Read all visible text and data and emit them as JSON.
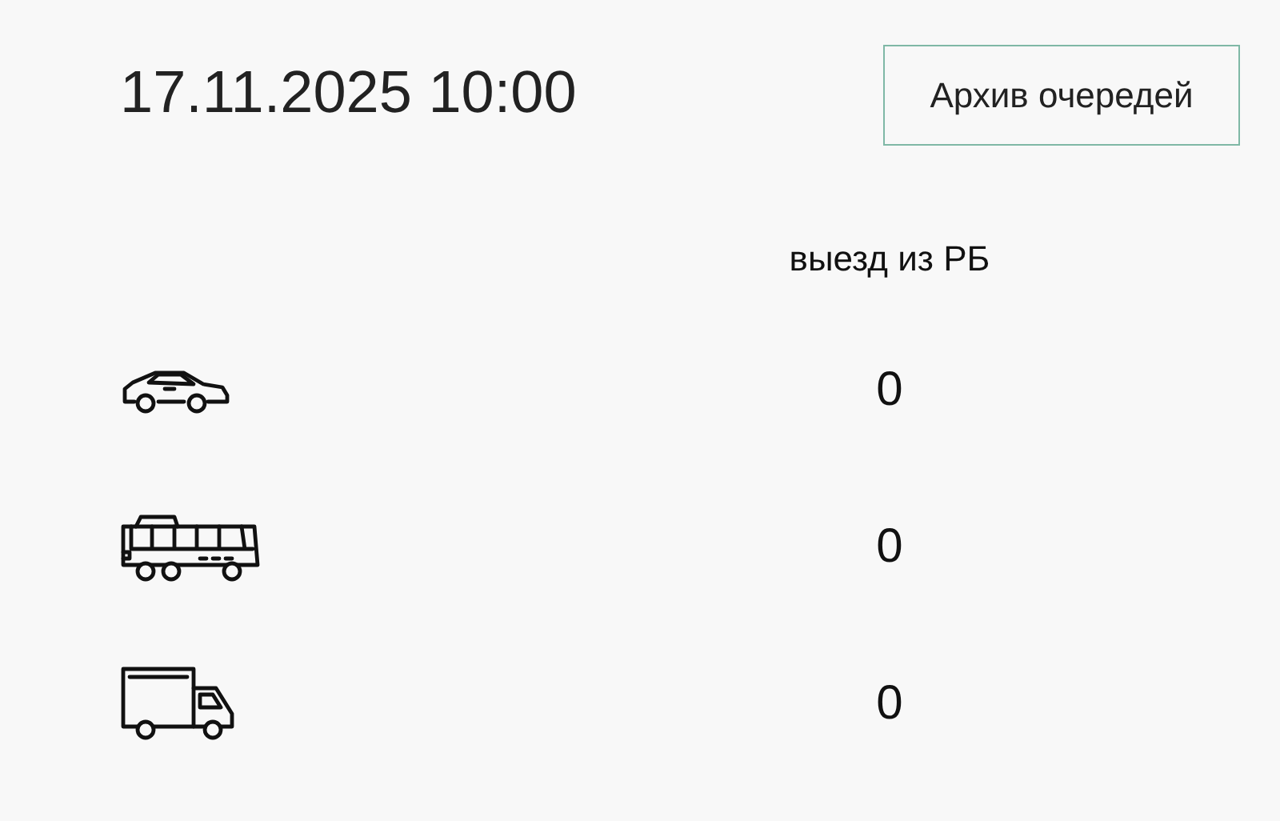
{
  "datetime": "17.11.2025 10:00",
  "archive_button": "Архив очередей",
  "column_header": "выезд из РБ",
  "rows": [
    {
      "kind": "car",
      "value": "0"
    },
    {
      "kind": "bus",
      "value": "0"
    },
    {
      "kind": "truck",
      "value": "0"
    }
  ]
}
